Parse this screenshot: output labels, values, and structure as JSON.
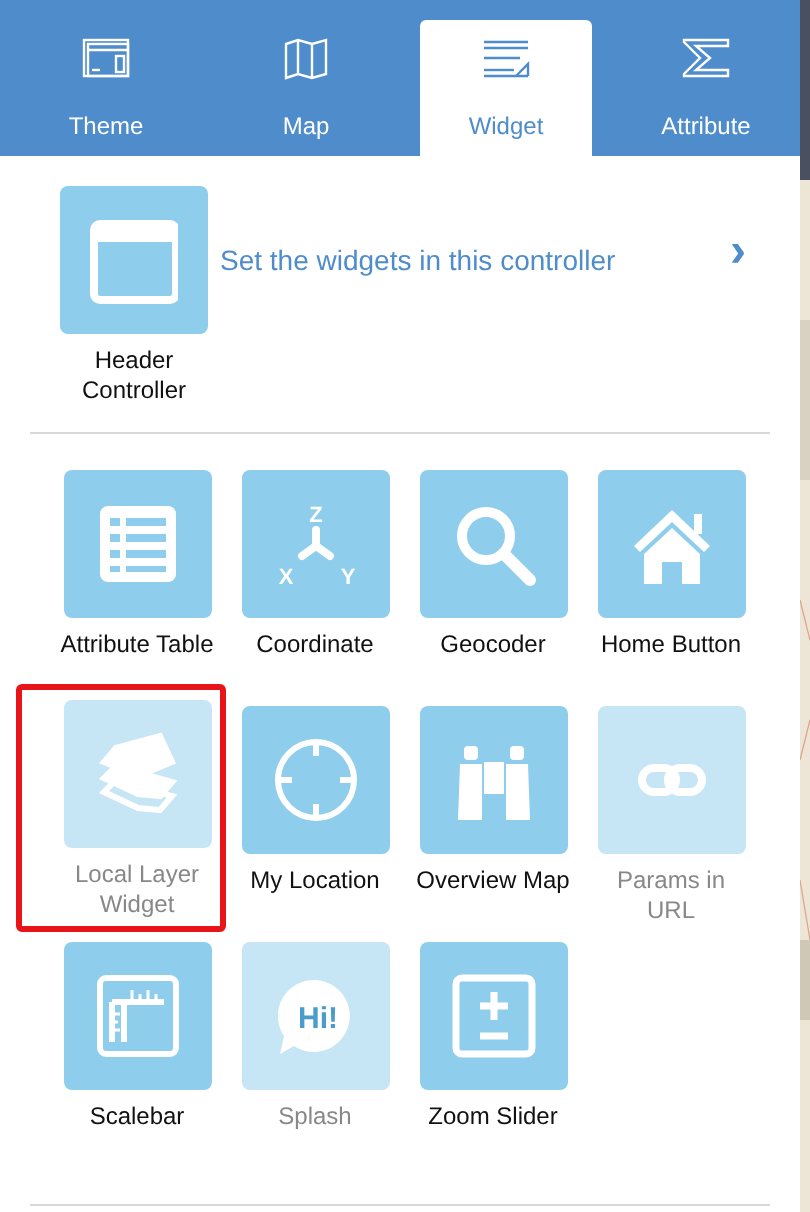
{
  "tabs": [
    {
      "label": "Theme",
      "kind": "theme",
      "selected": false
    },
    {
      "label": "Map",
      "kind": "map",
      "selected": false
    },
    {
      "label": "Widget",
      "kind": "widget",
      "selected": true
    },
    {
      "label": "Attribute",
      "kind": "attribute",
      "selected": false
    }
  ],
  "controller": {
    "name": "Header Controller",
    "description": "Set the widgets in this controller",
    "arrow": "›"
  },
  "widgets": [
    {
      "name": "Attribute Table",
      "kind": "table",
      "disabled": false,
      "outlined": false
    },
    {
      "name": "Coordinate",
      "kind": "coordinate",
      "axis_labels": [
        "Z",
        "X",
        "Y"
      ],
      "disabled": false,
      "outlined": false
    },
    {
      "name": "Geocoder",
      "kind": "search",
      "disabled": false,
      "outlined": false
    },
    {
      "name": "Home Button",
      "kind": "home",
      "disabled": false,
      "outlined": false
    },
    {
      "name": "Local Layer Widget",
      "kind": "layers",
      "disabled": true,
      "outlined": true
    },
    {
      "name": "My Location",
      "kind": "location",
      "disabled": false,
      "outlined": false
    },
    {
      "name": "Overview Map",
      "kind": "binoculars",
      "disabled": false,
      "outlined": false
    },
    {
      "name": "Params in URL",
      "kind": "link",
      "disabled": true,
      "outlined": false
    },
    {
      "name": "Scalebar",
      "kind": "scalebar",
      "disabled": false,
      "outlined": false
    },
    {
      "name": "Splash",
      "kind": "splash",
      "bubble_text": "Hi!",
      "disabled": true,
      "outlined": false
    },
    {
      "name": "Zoom Slider",
      "kind": "zoom",
      "disabled": false,
      "outlined": false
    }
  ]
}
